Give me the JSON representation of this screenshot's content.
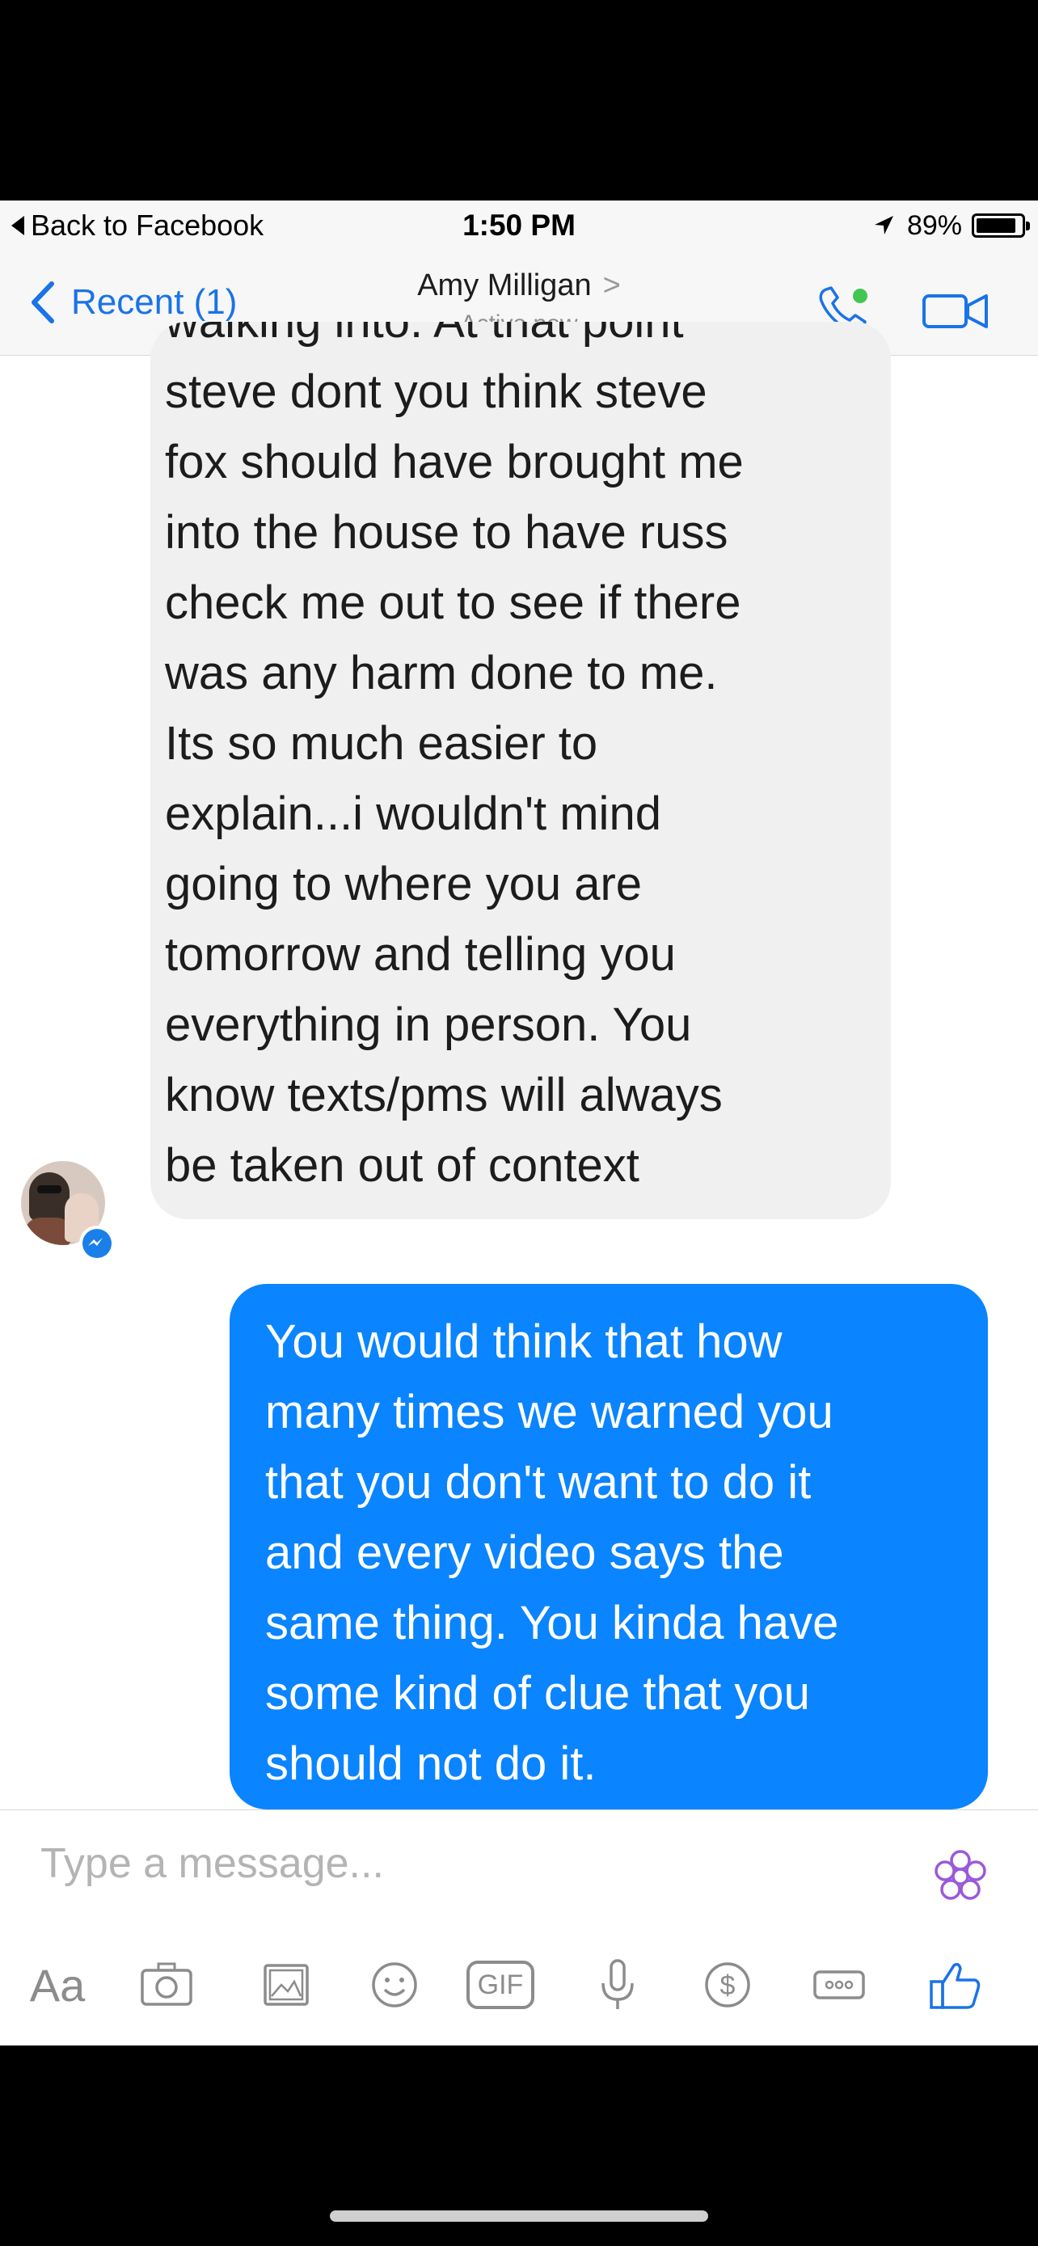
{
  "status_bar": {
    "back_label": "Back to Facebook",
    "time": "1:50 PM",
    "battery_percent": "89%",
    "battery_level": 0.89
  },
  "nav": {
    "back_label": "Recent (1)",
    "title": "Amy Milligan",
    "title_chevron": ">",
    "subtitle": "Active now",
    "icons": [
      "phone-icon",
      "video-camera-icon"
    ]
  },
  "messages": {
    "incoming": {
      "lines": [
        "walking into. At that point",
        "steve dont you think steve",
        "fox should have brought me",
        "into the house to have russ",
        "check me out to see if there",
        "was any harm done to me.",
        "Its so much easier to",
        "explain...i wouldn't mind",
        "going to where you are",
        "tomorrow and telling you",
        "everything in person. You",
        "know texts/pms will always",
        "be taken out of context"
      ]
    },
    "outgoing": {
      "lines": [
        "You would think that how",
        "many times we warned you",
        "that you don't want to do it",
        "and every video says the",
        "same thing.  You kinda have",
        "some kind of clue that you",
        "should not do it."
      ]
    }
  },
  "composer": {
    "placeholder": "Type a message...",
    "aa_label": "Aa",
    "gif_label": "GIF",
    "toolbar_icons": [
      "text-format-icon",
      "camera-icon",
      "gallery-icon",
      "emoji-icon",
      "gif-icon",
      "microphone-icon",
      "payment-icon",
      "more-icon",
      "thumbs-up-icon",
      "flower-icon"
    ]
  },
  "colors": {
    "accent": "#0a84ff",
    "incoming_bubble": "#f1f0f0",
    "active_dot": "#44c553"
  }
}
